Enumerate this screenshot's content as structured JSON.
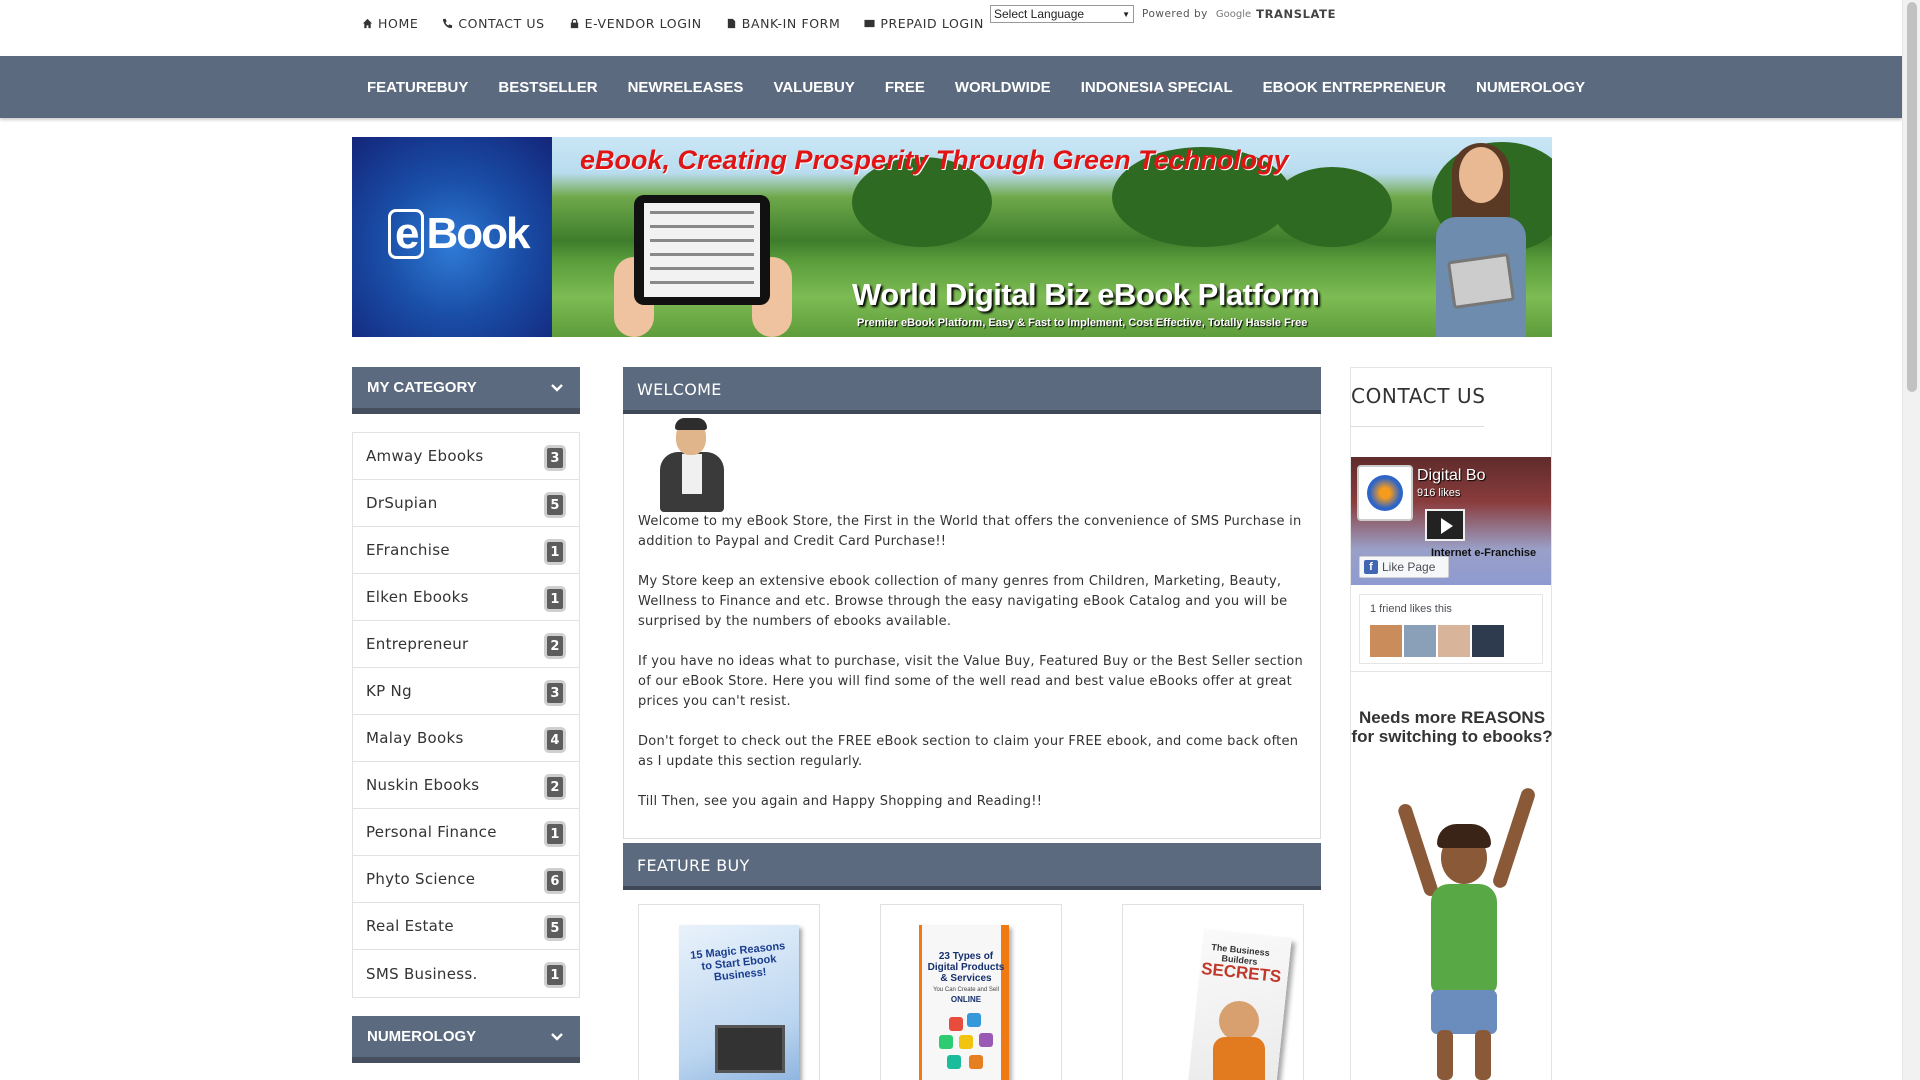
{
  "top_links": [
    {
      "label": "HOME",
      "icon": "home-icon"
    },
    {
      "label": "CONTACT US",
      "icon": "phone-icon"
    },
    {
      "label": "E-VENDOR LOGIN",
      "icon": "lock-icon"
    },
    {
      "label": "BANK-IN FORM",
      "icon": "document-icon"
    },
    {
      "label": "PREPAID LOGIN",
      "icon": "credit-card-icon"
    }
  ],
  "translate": {
    "select_label": "Select Language",
    "powered_by": "Powered by",
    "google": "Google",
    "translate": "TRANSLATE"
  },
  "main_nav": [
    "FEATUREBUY",
    "BESTSELLER",
    "NEWRELEASES",
    "VALUEBUY",
    "FREE",
    "WORLDWIDE",
    "INDONESIA SPECIAL",
    "EBOOK ENTREPRENEUR",
    "NUMEROLOGY"
  ],
  "banner": {
    "logo_text_e": "e",
    "logo_text_book": "Book",
    "tagline": "eBook, Creating Prosperity Through Green Technology",
    "title": "World Digital Biz eBook Platform",
    "subtitle": "Premier eBook Platform, Easy & Fast to Implement, Cost Effective, Totally Hassle Free"
  },
  "sidebar": {
    "category_title": "MY CATEGORY",
    "categories": [
      {
        "name": "Amway Ebooks",
        "count": "3"
      },
      {
        "name": "DrSupian",
        "count": "5"
      },
      {
        "name": "EFranchise",
        "count": "1"
      },
      {
        "name": "Elken Ebooks",
        "count": "1"
      },
      {
        "name": "Entrepreneur",
        "count": "2"
      },
      {
        "name": "KP Ng",
        "count": "3"
      },
      {
        "name": "Malay Books",
        "count": "4"
      },
      {
        "name": "Nuskin Ebooks",
        "count": "2"
      },
      {
        "name": "Personal Finance",
        "count": "1"
      },
      {
        "name": "Phyto Science",
        "count": "6"
      },
      {
        "name": "Real Estate",
        "count": "5"
      },
      {
        "name": "SMS Business.",
        "count": "1"
      }
    ],
    "numerology_title": "NUMEROLOGY"
  },
  "welcome": {
    "title": "WELCOME",
    "paragraphs": [
      "Welcome to my eBook Store, the First in the World that offers the convenience of SMS Purchase in addition to Paypal and Credit Card Purchase!!",
      "My Store keep an extensive ebook collection of many genres from Children, Marketing, Beauty, Wellness to Finance and etc. Browse through the easy navigating eBook Catalog and you will be surprised by the numbers of ebooks available.",
      "If you have no ideas what to purchase, visit the Value Buy, Featured Buy or the Best Seller section of our eBook Store. Here you will find some of the well read and best value eBooks offer at great prices you can't resist.",
      "Don't forget to check out the FREE eBook section to claim your FREE ebook, and come back often as I update this section regularly.",
      "Till Then, see you again and Happy Shopping and Reading!!"
    ]
  },
  "feature": {
    "title": "FEATURE BUY",
    "books": [
      {
        "cover_text": "15 Magic Reasons to Start Ebook Business!"
      },
      {
        "cover_text": "23 Types of Digital Products & Services",
        "cover_sub": "You Can Create and Sell",
        "cover_sub2": "ONLINE"
      },
      {
        "cover_text": "The Business Builders",
        "cover_big": "SECRETS"
      }
    ]
  },
  "contact": {
    "title": "CONTACT US",
    "fb_name": "Digital Bo",
    "fb_likes": "916 likes",
    "fb_caption": "Internet e-Franchise",
    "fb_like_button": "Like Page",
    "fb_friends": "1 friend likes this"
  },
  "ad": {
    "line1": "Needs more REASONS",
    "line2": "for switching to ebooks?"
  },
  "colors": {
    "nav_bg": "#5b6a7e",
    "header_bg": "#5b6a7e",
    "badge_bg": "#5d5d5d",
    "tagline_red": "#e01414"
  }
}
